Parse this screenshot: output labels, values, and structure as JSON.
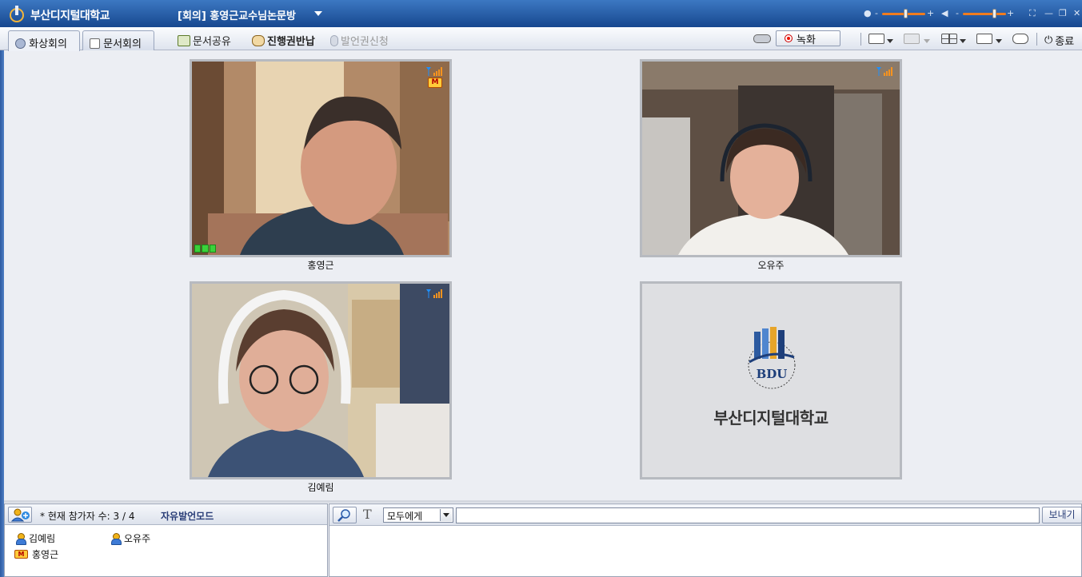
{
  "window": {
    "app_title": "부산디지털대학교",
    "room_title": "[회의] 홍영근교수님논문방"
  },
  "toolbar": {
    "tab_video": "화상회의",
    "tab_document": "문서회의",
    "share_doc": "문서공유",
    "return_control": "진행권반납",
    "request_speak": "발언권신청",
    "record": "녹화",
    "end": "종료"
  },
  "videos": [
    {
      "name": "홍영근"
    },
    {
      "name": "오유주"
    },
    {
      "name": "김예림"
    }
  ],
  "logo_tile": {
    "emblem_text": "BDU",
    "school_name": "부산디지털대학교"
  },
  "participants": {
    "count_text": "* 현재 참가자 수: 3 / 4",
    "mode": "자유발언모드",
    "items": [
      {
        "name": "김예림",
        "role": "member"
      },
      {
        "name": "오유주",
        "role": "member"
      },
      {
        "name": "홍영근",
        "role": "moderator",
        "badge": "M"
      }
    ]
  },
  "chat": {
    "target": "모두에게",
    "input_value": "",
    "send_label": "보내기"
  },
  "colors": {
    "title_bar": "#1f56a3",
    "accent_orange": "#f07c1e",
    "mode_text": "#2a3e78"
  }
}
